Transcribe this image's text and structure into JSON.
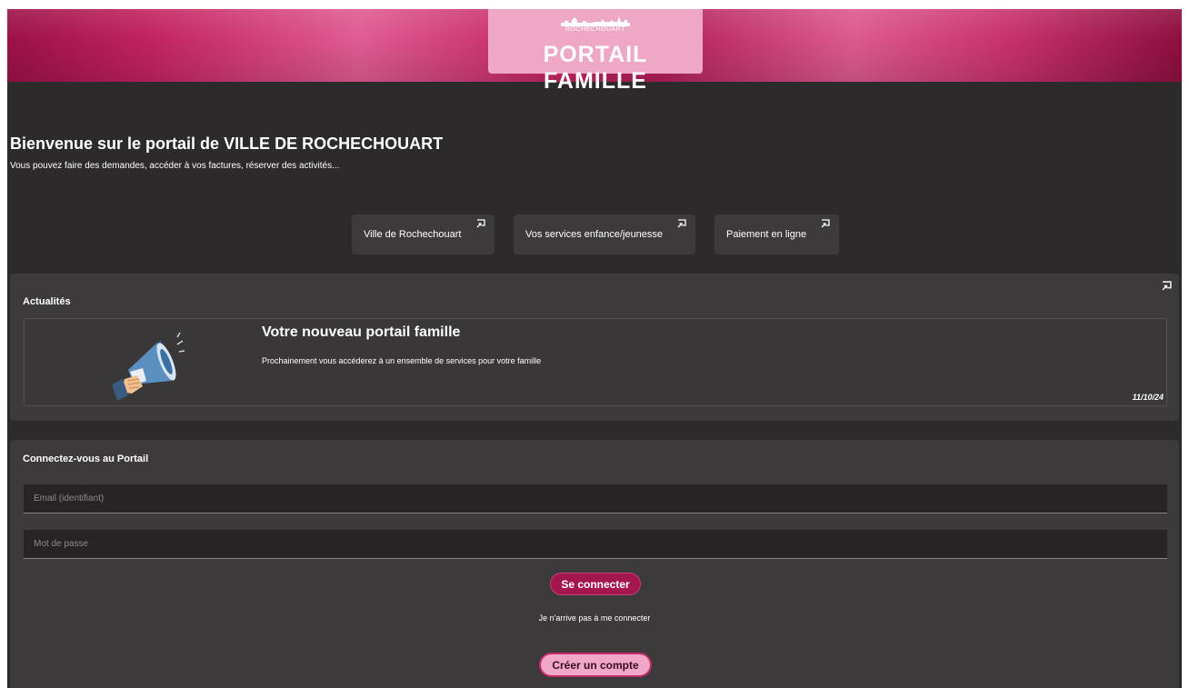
{
  "header": {
    "logo_small_text": "ROCHECHOUART",
    "logo_title": "PORTAIL FAMILLE"
  },
  "welcome": {
    "title": "Bienvenue sur le portail de VILLE DE ROCHECHOUART",
    "subtitle": "Vous pouvez faire des demandes, accéder à vos factures, réserver des activités..."
  },
  "quick_links": [
    {
      "label": "Ville de Rochechouart",
      "icon": "external-link-icon"
    },
    {
      "label": "Vos services enfance/jeunesse",
      "icon": "external-link-icon"
    },
    {
      "label": "Paiement en ligne",
      "icon": "external-link-icon"
    }
  ],
  "news": {
    "section_title": "Actualités",
    "item": {
      "title": "Votre nouveau portail famille",
      "text": "Prochainement vous accéderez à un ensemble de services pour votre famille",
      "date": "11/10/24",
      "image_icon": "megaphone-icon"
    }
  },
  "login": {
    "section_title": "Connectez-vous au Portail",
    "email_placeholder": "Email (identifiant)",
    "email_value": "",
    "password_placeholder": "Mot de passe",
    "password_value": "",
    "submit_label": "Se connecter",
    "forgot_label": "Je n'arrive pas à me connecter",
    "create_label": "Créer un compte"
  },
  "colors": {
    "accent": "#a3174e",
    "banner": "#c2235f",
    "background": "#2c2a2b",
    "card": "#3d3a3c",
    "create_button": "#f1a7c7"
  }
}
